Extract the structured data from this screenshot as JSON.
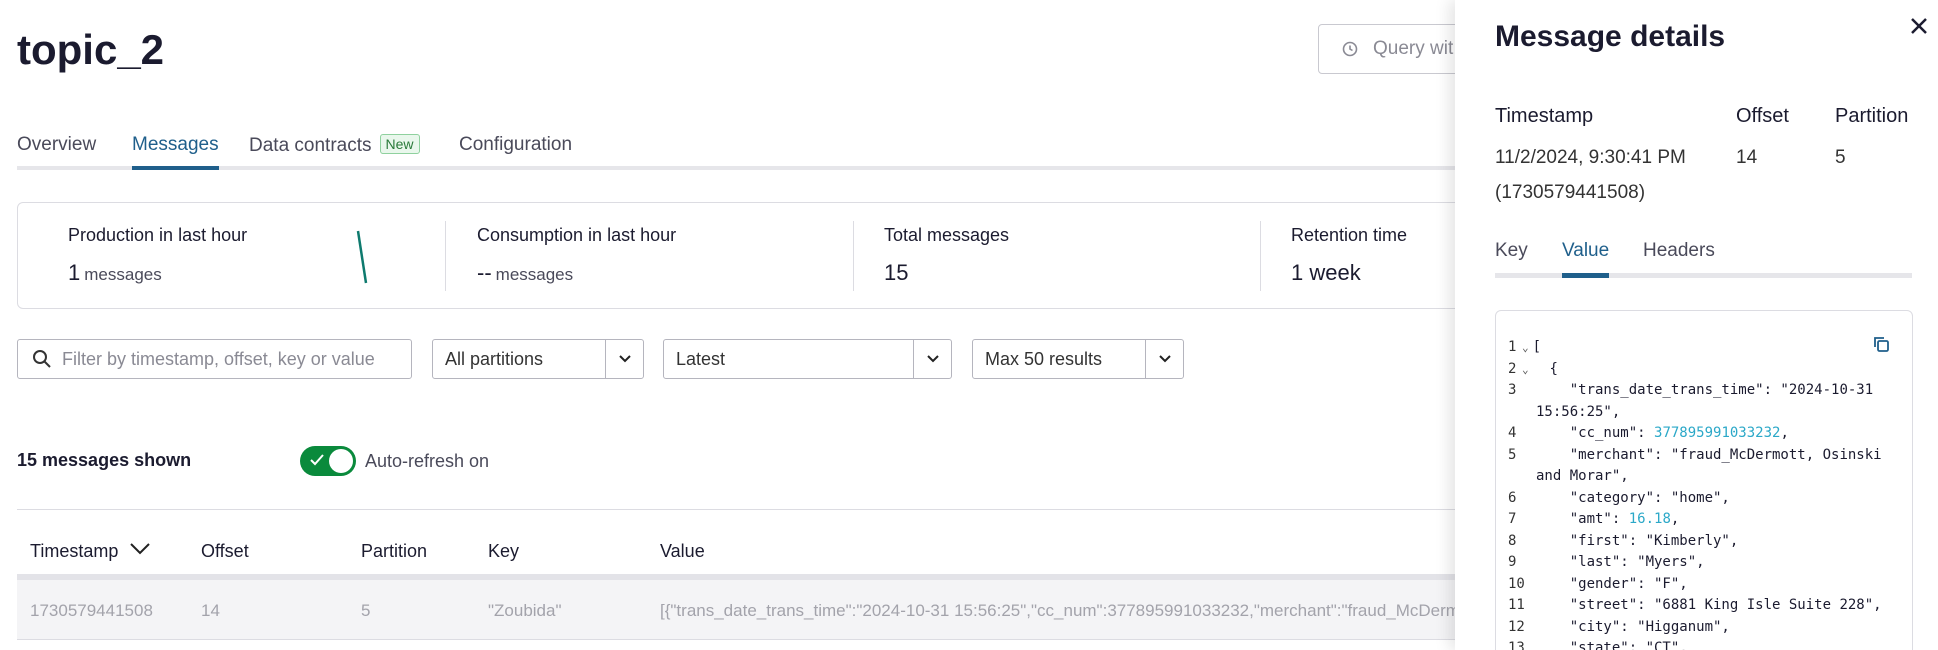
{
  "page": {
    "title": "topic_2",
    "query_button_label": "Query wit"
  },
  "tabs": [
    {
      "label": "Overview"
    },
    {
      "label": "Messages"
    },
    {
      "label": "Data contracts",
      "badge": "New"
    },
    {
      "label": "Configuration"
    }
  ],
  "stats": {
    "production": {
      "label": "Production in last hour",
      "value": "1",
      "unit": "messages"
    },
    "consumption": {
      "label": "Consumption in last hour",
      "value": "--",
      "unit": "messages"
    },
    "total": {
      "label": "Total messages",
      "value": "15"
    },
    "retention": {
      "label": "Retention time",
      "value": "1 week"
    }
  },
  "filters": {
    "search_placeholder": "Filter by timestamp, offset, key or value",
    "partition": "All partitions",
    "position": "Latest",
    "limit": "Max 50 results"
  },
  "messages_shown": "15 messages shown",
  "auto_refresh_label": "Auto-refresh on",
  "table": {
    "headers": [
      "Timestamp",
      "Offset",
      "Partition",
      "Key",
      "Value"
    ],
    "rows": [
      {
        "timestamp": "1730579441508",
        "offset": "14",
        "partition": "5",
        "key": "\"Zoubida\"",
        "value": "[{\"trans_date_trans_time\":\"2024-10-31 15:56:25\",\"cc_num\":377895991033232,\"merchant\":\"fraud_McDermott, Os"
      }
    ]
  },
  "drawer": {
    "title": "Message details",
    "timestamp_label": "Timestamp",
    "timestamp_value": "11/2/2024, 9:30:41 PM",
    "timestamp_raw": "(1730579441508)",
    "offset_label": "Offset",
    "offset_value": "14",
    "partition_label": "Partition",
    "partition_value": "5",
    "tabs": [
      "Key",
      "Value",
      "Headers"
    ],
    "code_lines": [
      {
        "no": "1",
        "fold": true,
        "text": "["
      },
      {
        "no": "2",
        "fold": true,
        "text": "  {"
      },
      {
        "no": "3",
        "text": "    \"trans_date_trans_time\": \"2024-10-31 15:56:25\","
      },
      {
        "no": "4",
        "text": "    \"cc_num\": ",
        "num": "377895991033232",
        "tail": ","
      },
      {
        "no": "5",
        "text": "    \"merchant\": \"fraud_McDermott, Osinski and Morar\","
      },
      {
        "no": "6",
        "text": "    \"category\": \"home\","
      },
      {
        "no": "7",
        "text": "    \"amt\": ",
        "num": "16.18",
        "tail": ","
      },
      {
        "no": "8",
        "text": "    \"first\": \"Kimberly\","
      },
      {
        "no": "9",
        "text": "    \"last\": \"Myers\","
      },
      {
        "no": "10",
        "text": "    \"gender\": \"F\","
      },
      {
        "no": "11",
        "text": "    \"street\": \"6881 King Isle Suite 228\","
      },
      {
        "no": "12",
        "text": "    \"city\": \"Higganum\","
      },
      {
        "no": "13",
        "text": "    \"state\": \"CT\","
      }
    ]
  },
  "colors": {
    "accent": "#1f5f8b",
    "toggle_on": "#0a8a3c",
    "number_token": "#2ba8c8",
    "sparkline": "#0e7a6e"
  }
}
